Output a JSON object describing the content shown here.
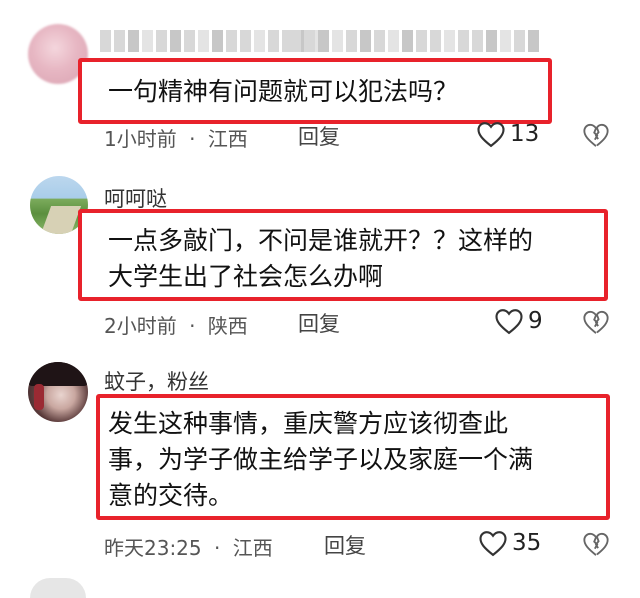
{
  "comments": [
    {
      "username": "",
      "text": "一句精神有问题就可以犯法吗？",
      "time": "1小时前",
      "location": "江西",
      "reply_label": "回复",
      "likes": "13"
    },
    {
      "username": "呵呵哒",
      "text": "一点多敲门，不问是谁就开？？这样的\n大学生出了社会怎么办啊",
      "time": "2小时前",
      "location": "陕西",
      "reply_label": "回复",
      "likes": "9"
    },
    {
      "username": "蚊子，粉丝",
      "text": "发生这种事情，重庆警方应该彻查此\n事，为学子做主给学子以及家庭一个满\n意的交待。",
      "time": "昨天23:25",
      "location": "江西",
      "reply_label": "回复",
      "likes": "35"
    }
  ],
  "separator": "·",
  "icons": {
    "like": "heart-outline-icon",
    "dislike": "broken-heart-icon"
  },
  "colors": {
    "highlight_border": "#e8222b"
  }
}
